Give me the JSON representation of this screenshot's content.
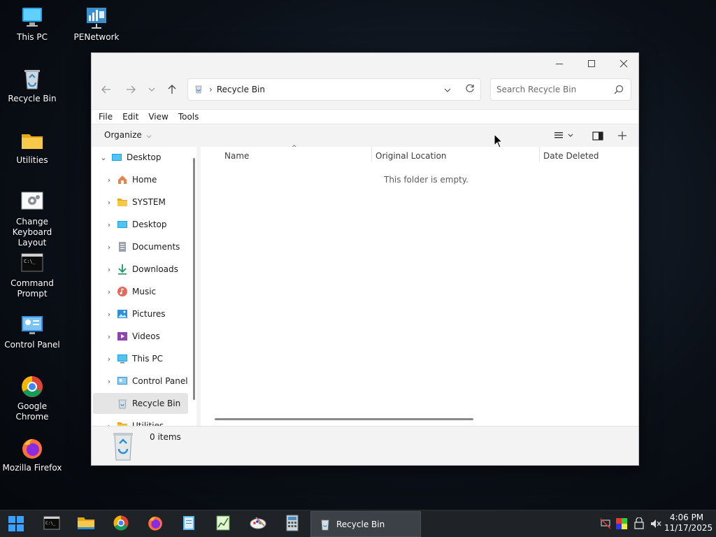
{
  "desktop": {
    "icons": [
      {
        "label": "This PC"
      },
      {
        "label": "PENetwork"
      },
      {
        "label": "Recycle Bin"
      },
      {
        "label": "Utilities"
      },
      {
        "label": "Change Keyboard Layout"
      },
      {
        "label": "Command Prompt"
      },
      {
        "label": "Control Panel"
      },
      {
        "label": "Google Chrome"
      },
      {
        "label": "Mozilla Firefox"
      }
    ]
  },
  "window": {
    "address": {
      "current": "Recycle Bin"
    },
    "search": {
      "placeholder": "Search Recycle Bin"
    },
    "menu": [
      "File",
      "Edit",
      "View",
      "Tools"
    ],
    "command_bar": {
      "organize_label": "Organize"
    },
    "nav": {
      "root": "Desktop",
      "items": [
        {
          "label": "Home",
          "icon": "home-icon"
        },
        {
          "label": "SYSTEM",
          "icon": "folder-icon"
        },
        {
          "label": "Desktop",
          "icon": "desktop-icon"
        },
        {
          "label": "Documents",
          "icon": "documents-icon"
        },
        {
          "label": "Downloads",
          "icon": "downloads-icon"
        },
        {
          "label": "Music",
          "icon": "music-icon"
        },
        {
          "label": "Pictures",
          "icon": "pictures-icon"
        },
        {
          "label": "Videos",
          "icon": "videos-icon"
        },
        {
          "label": "This PC",
          "icon": "this-pc-icon"
        },
        {
          "label": "Control Panel",
          "icon": "control-panel-icon"
        },
        {
          "label": "Recycle Bin",
          "icon": "recycle-bin-icon"
        },
        {
          "label": "Utilities",
          "icon": "folder-icon"
        }
      ]
    },
    "columns": [
      "Name",
      "Original Location",
      "Date Deleted"
    ],
    "empty_message": "This folder is empty.",
    "status": {
      "item_count": "0 items"
    }
  },
  "taskbar": {
    "active_window": "Recycle Bin",
    "clock": {
      "time": "4:06 PM",
      "date": "11/17/2025"
    }
  },
  "colors": {
    "accent": "#0078d4",
    "folder": "#f4c542",
    "taskbar": "#1f2328",
    "selected_nav": "#e5e5e5"
  }
}
